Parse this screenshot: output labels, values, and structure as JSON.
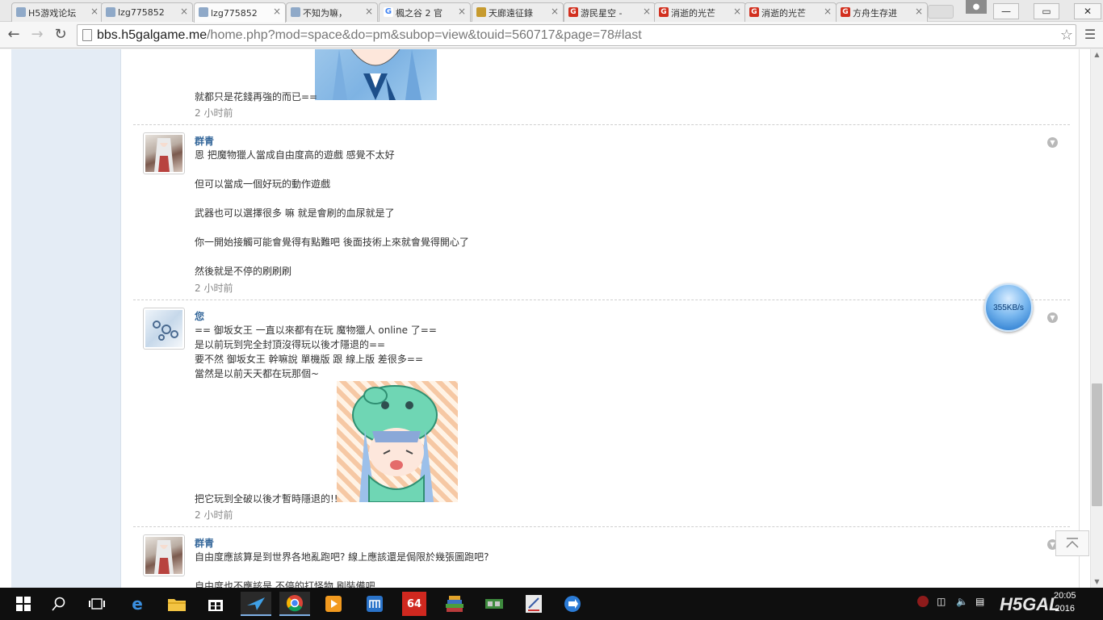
{
  "browser": {
    "tabs": [
      {
        "label": "H5游戏论坛",
        "favicon_color": "#8fa9c8"
      },
      {
        "label": "lzg775852",
        "favicon_color": "#8fa9c8"
      },
      {
        "label": "lzg775852",
        "favicon_color": "#8fa9c8",
        "active": true
      },
      {
        "label": "不知为嘛，",
        "favicon_color": "#8fa9c8"
      },
      {
        "label": "楓之谷 2 官",
        "favicon_color": "#4285f4"
      },
      {
        "label": "天廊遠征錄",
        "favicon_color": "#c79b2f"
      },
      {
        "label": "游民星空 -",
        "favicon_color": "#d2301f"
      },
      {
        "label": "消逝的光芒",
        "favicon_color": "#d2301f"
      },
      {
        "label": "消逝的光芒",
        "favicon_color": "#d2301f"
      },
      {
        "label": "方舟生存进",
        "favicon_color": "#d2301f"
      }
    ],
    "url_host": "bbs.h5galgame.me",
    "url_path": "/home.php?mod=space&do=pm&subop=view&touid=560717&page=78#last"
  },
  "messages": [
    {
      "text": "就都只是花錢再強的而已==",
      "time": "2 小时前"
    },
    {
      "author": "群青",
      "lines": [
        "恩 把魔物獵人當成自由度高的遊戲 感覺不太好",
        "",
        "但可以當成一個好玩的動作遊戲",
        "",
        "武器也可以選擇很多  嘛  就是會刷的血尿就是了",
        "",
        "你一開始接觸可能會覺得有點難吧  後面技術上來就會覺得開心了",
        "",
        "然後就是不停的刷刷刷"
      ],
      "time": "2 小时前"
    },
    {
      "author": "您",
      "lines": [
        "== 御坂女王 一直以來都有在玩 魔物獵人 online 了==",
        "是以前玩到完全封頂沒得玩以後才隱退的==",
        "要不然 御坂女王 幹嘛說 單機版 跟 線上版 差很多==",
        "當然是以前天天都在玩那個~"
      ],
      "caption": "把它玩到全破以後才暫時隱退的!!",
      "time": "2 小时前"
    },
    {
      "author": "群青",
      "lines": [
        "自由度應該算是到世界各地亂跑吧?  線上應該還是侷限於幾張圖跑吧?",
        "",
        "自由度也不應該是  不停的打怪物  刷裝備吧"
      ]
    }
  ],
  "speed_meter": "355KB/s",
  "taskbar": {
    "tray_icons": [
      "network-icon",
      "volume-icon",
      "notification-icon"
    ],
    "clock_time": "20:05",
    "clock_date": "2016",
    "watermark": "H5GAL"
  }
}
